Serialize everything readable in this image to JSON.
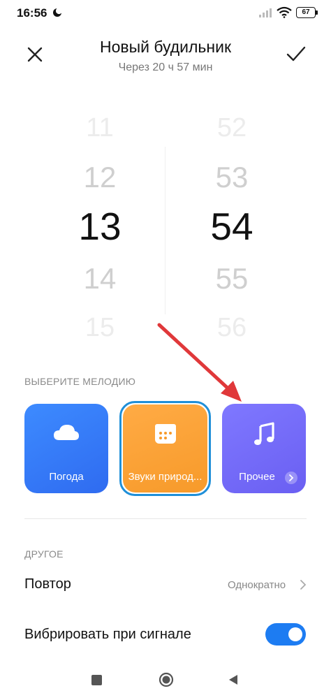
{
  "status_bar": {
    "time": "16:56",
    "battery": "67"
  },
  "header": {
    "title": "Новый будильник",
    "subtitle": "Через 20 ч 57 мин"
  },
  "picker": {
    "hours": [
      "11",
      "12",
      "13",
      "14",
      "15"
    ],
    "minutes": [
      "52",
      "53",
      "54",
      "55",
      "56"
    ],
    "selected_hour": "13",
    "selected_minute": "54"
  },
  "melody": {
    "section_label": "ВЫБЕРИТЕ МЕЛОДИЮ",
    "tiles": [
      {
        "label": "Погода",
        "icon": "cloud-icon"
      },
      {
        "label": "Звуки природ...",
        "icon": "grid-icon"
      },
      {
        "label": "Прочее",
        "icon": "music-note-icon"
      }
    ]
  },
  "other": {
    "section_label": "ДРУГОЕ",
    "repeat_label": "Повтор",
    "repeat_value": "Однократно",
    "vibrate_label": "Вибрировать при сигнале",
    "vibrate_on": true
  },
  "colors": {
    "weather_tile": "#2f6bf0",
    "nature_tile": "#f79a2a",
    "other_tile": "#6a5ff2",
    "selection_ring": "#1f8fd8",
    "toggle_on": "#1d7cf2",
    "annotation_arrow": "#e0383a"
  }
}
